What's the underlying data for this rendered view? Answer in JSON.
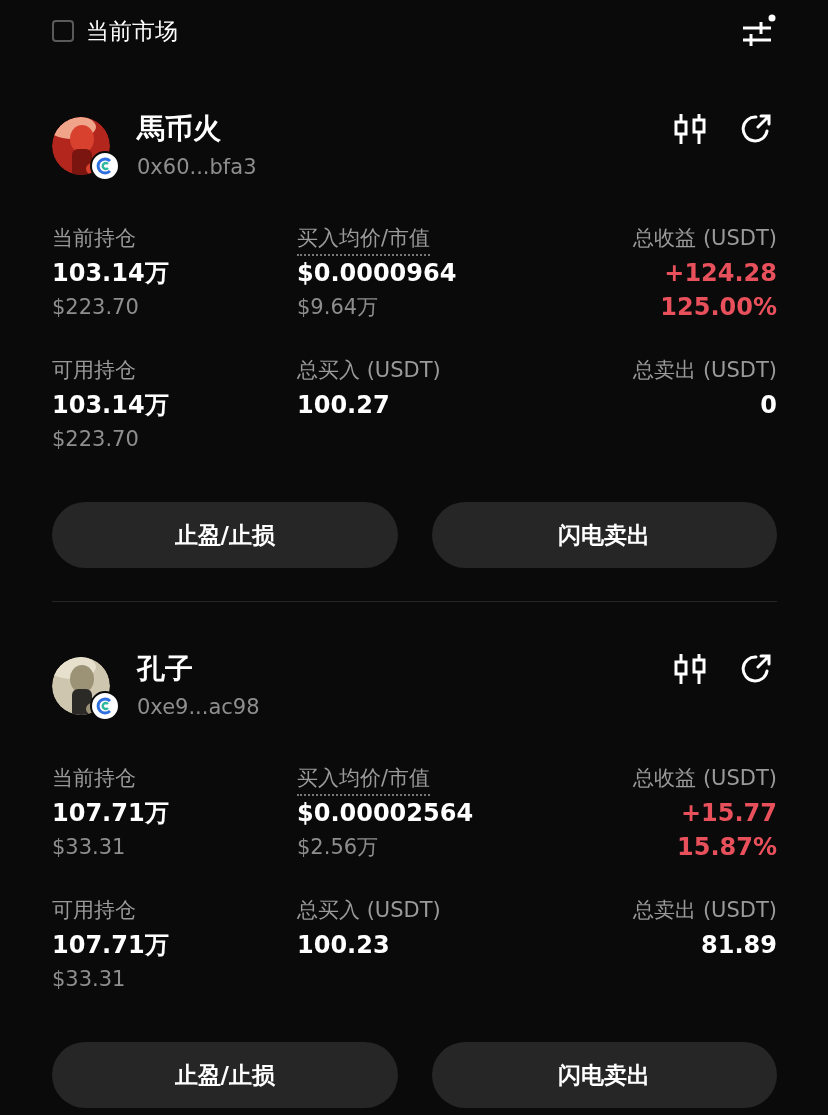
{
  "filter_bar": {
    "checkbox": {
      "label": "当前市场",
      "checked": false
    }
  },
  "positions": [
    {
      "name": "馬币火",
      "address": "0x60...bfa3",
      "stats": [
        {
          "label": "当前持仓",
          "dotted_underline": false,
          "lines": [
            {
              "text": "103.14万",
              "kind": "primary"
            },
            {
              "text": "$223.70",
              "kind": "secondary"
            }
          ]
        },
        {
          "label": "买入均价/市值",
          "dotted_underline": true,
          "lines": [
            {
              "text": "$0.0000964",
              "kind": "primary"
            },
            {
              "text": "$9.64万",
              "kind": "secondary"
            }
          ]
        },
        {
          "label": "总收益 (USDT)",
          "dotted_underline": false,
          "lines": [
            {
              "text": "+124.28",
              "kind": "gain"
            },
            {
              "text": "125.00%",
              "kind": "gain"
            }
          ]
        },
        {
          "label": "可用持仓",
          "dotted_underline": false,
          "lines": [
            {
              "text": "103.14万",
              "kind": "primary"
            },
            {
              "text": "$223.70",
              "kind": "secondary"
            }
          ]
        },
        {
          "label": "总买入 (USDT)",
          "dotted_underline": false,
          "lines": [
            {
              "text": "100.27",
              "kind": "primary"
            }
          ]
        },
        {
          "label": "总卖出 (USDT)",
          "dotted_underline": false,
          "lines": [
            {
              "text": "0",
              "kind": "primary"
            }
          ]
        }
      ],
      "buttons": [
        "止盈/止损",
        "闪电卖出"
      ]
    },
    {
      "name": "孔子",
      "address": "0xe9...ac98",
      "stats": [
        {
          "label": "当前持仓",
          "dotted_underline": false,
          "lines": [
            {
              "text": "107.71万",
              "kind": "primary"
            },
            {
              "text": "$33.31",
              "kind": "secondary"
            }
          ]
        },
        {
          "label": "买入均价/市值",
          "dotted_underline": true,
          "lines": [
            {
              "text": "$0.00002564",
              "kind": "primary"
            },
            {
              "text": "$2.56万",
              "kind": "secondary"
            }
          ]
        },
        {
          "label": "总收益 (USDT)",
          "dotted_underline": false,
          "lines": [
            {
              "text": "+15.77",
              "kind": "gain"
            },
            {
              "text": "15.87%",
              "kind": "gain"
            }
          ]
        },
        {
          "label": "可用持仓",
          "dotted_underline": false,
          "lines": [
            {
              "text": "107.71万",
              "kind": "primary"
            },
            {
              "text": "$33.31",
              "kind": "secondary"
            }
          ]
        },
        {
          "label": "总买入 (USDT)",
          "dotted_underline": false,
          "lines": [
            {
              "text": "100.23",
              "kind": "primary"
            }
          ]
        },
        {
          "label": "总卖出 (USDT)",
          "dotted_underline": false,
          "lines": [
            {
              "text": "81.89",
              "kind": "primary"
            }
          ]
        }
      ],
      "buttons": [
        "止盈/止损",
        "闪电卖出"
      ]
    }
  ]
}
